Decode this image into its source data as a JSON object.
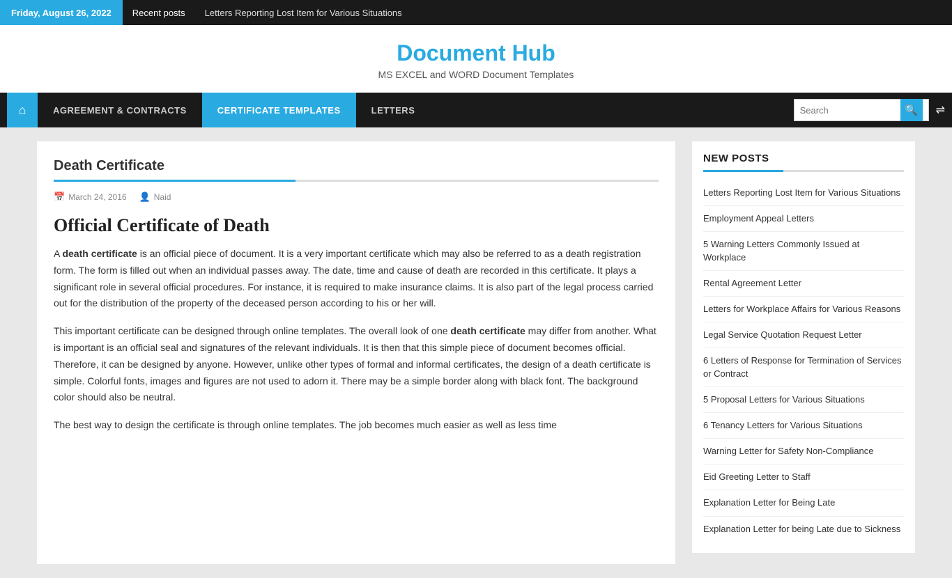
{
  "topBar": {
    "date": "Friday, August 26, 2022",
    "recentLabel": "Recent posts",
    "tickerText": "Letters Reporting Lost Item for Various Situations"
  },
  "siteHeader": {
    "title": "Document Hub",
    "subtitle": "MS EXCEL and WORD Document Templates"
  },
  "nav": {
    "homeIcon": "⌂",
    "items": [
      {
        "label": "AGREEMENT & CONTRACTS",
        "active": false
      },
      {
        "label": "CERTIFICATE TEMPLATES",
        "active": true
      },
      {
        "label": "LETTERS",
        "active": false
      }
    ],
    "searchPlaceholder": "Search",
    "searchIcon": "🔍",
    "shuffleIcon": "⇌"
  },
  "article": {
    "title": "Death Certificate",
    "meta": {
      "date": "March 24, 2016",
      "dateIcon": "📅",
      "author": "Naid",
      "authorIcon": "👤"
    },
    "heading": "Official Certificate of Death",
    "paragraphs": [
      "A <b>death certificate</b> is an official piece of document. It is a very important certificate which may also be referred to as a death registration form. The form is filled out when an individual passes away. The date, time and cause of death are recorded in this certificate. It plays a significant role in several official procedures. For instance, it is required to make insurance claims. It is also part of the legal process carried out for the distribution of the property of the deceased person according to his or her will.",
      "This important certificate can be designed through online templates. The overall look of one <b>death certificate</b> may differ from another. What is important is an official seal and signatures of the relevant individuals. It is then that this simple piece of document becomes official. Therefore, it can be designed by anyone. However, unlike other types of formal and informal certificates, the design of a death certificate is simple. Colorful fonts, images and figures are not used to adorn it. There may be a simple border along with black font. The background color should also be neutral.",
      "The best way to design the certificate is through online templates. The job becomes much easier as well as less time"
    ]
  },
  "sidebar": {
    "newPostsTitle": "NEW POSTS",
    "links": [
      "Letters Reporting Lost Item for Various Situations",
      "Employment Appeal Letters",
      "5 Warning Letters Commonly Issued at Workplace",
      "Rental Agreement Letter",
      "Letters for Workplace Affairs for Various Reasons",
      "Legal Service Quotation Request Letter",
      "6 Letters of Response for Termination of Services or Contract",
      "5 Proposal Letters for Various Situations",
      "6 Tenancy Letters for Various Situations",
      "Warning Letter for Safety Non-Compliance",
      "Eid Greeting Letter to Staff",
      "Explanation Letter for Being Late",
      "Explanation Letter for being Late due to Sickness"
    ]
  }
}
